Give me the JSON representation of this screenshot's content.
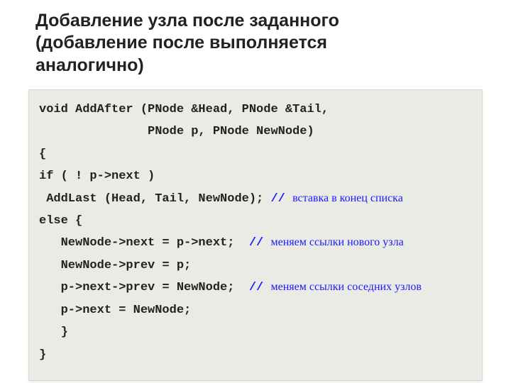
{
  "title": {
    "line1": "Добавление узла после заданного",
    "line2": "(добавление после выполняется",
    "line3": "аналогично)"
  },
  "code": {
    "l1": "void AddAfter (PNode &Head, PNode &Tail,",
    "l2": "               PNode p, PNode NewNode)",
    "l3": "{",
    "l4": "if ( ! p->next )",
    "l5a": " AddLast (Head, Tail, NewNode); ",
    "l5s": "// ",
    "l5c": "вставка в конец списка",
    "l6": "else {",
    "l7a": "   NewNode->next = p->next;  ",
    "l7s": "// ",
    "l7c": "меняем ссылки нового узла",
    "l8": "   NewNode->prev = p;",
    "l9a": "   p->next->prev = NewNode;  ",
    "l9s": "// ",
    "l9c": "меняем ссылки соседних узлов",
    "l10": "   p->next = NewNode;",
    "l11": "   }",
    "l12": "}"
  }
}
